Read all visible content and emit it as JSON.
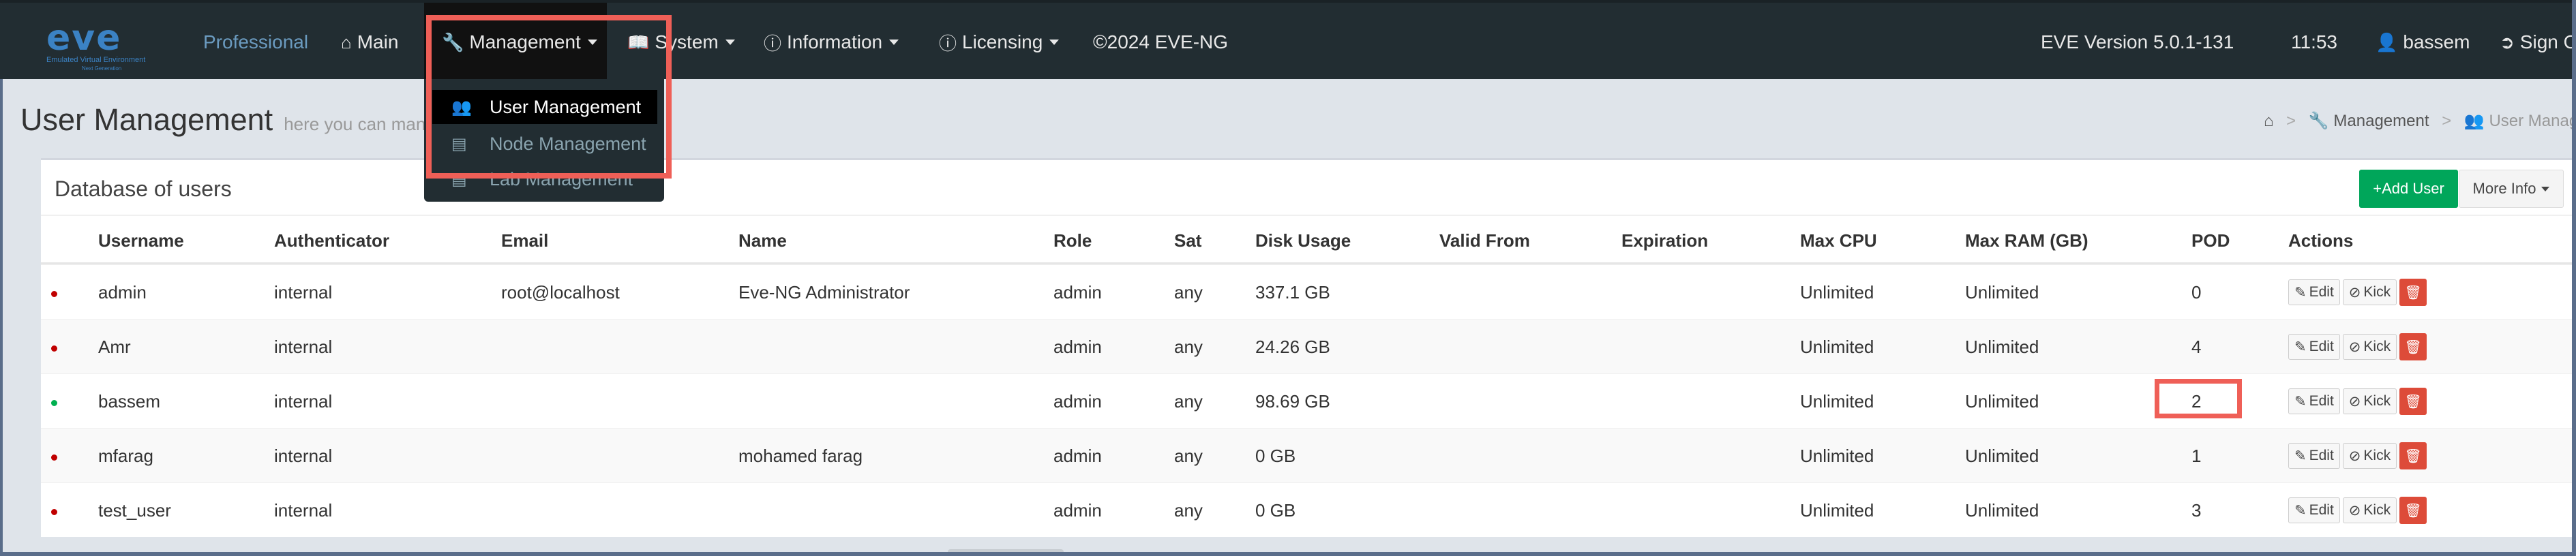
{
  "navbar": {
    "logo_text": "eve",
    "logo_tagline": "Emulated Virtual Environment",
    "logo_subtag": "Next Generation",
    "professional": "Professional",
    "main": "Main",
    "management": "Management",
    "system": "System",
    "information": "Information",
    "licensing": "Licensing",
    "copyright": "©2024 EVE-NG",
    "version": "EVE Version 5.0.1-131",
    "time": "11:53",
    "user": "bassem",
    "signout": "Sign Out"
  },
  "dropdown": {
    "items": [
      {
        "label": "User Management",
        "icon": "users-icon"
      },
      {
        "label": "Node Management",
        "icon": "hdd-icon"
      },
      {
        "label": "Lab Management",
        "icon": "hdd-icon"
      }
    ]
  },
  "page": {
    "title": "User Management",
    "subtitle": "here you can manage users",
    "breadcrumb": [
      "Management",
      "User Management"
    ]
  },
  "box": {
    "title": "Database of users",
    "add_user": "+Add User",
    "more_info": "More Info"
  },
  "table": {
    "headers": [
      "Username",
      "Authenticator",
      "Email",
      "Name",
      "Role",
      "Sat",
      "Disk Usage",
      "Valid From",
      "Expiration",
      "Max CPU",
      "Max RAM (GB)",
      "POD",
      "Actions"
    ],
    "rows": [
      {
        "status": "offline",
        "status_color": "#c00000",
        "username": "admin",
        "auth": "internal",
        "email": "root@localhost",
        "name": "Eve-NG Administrator",
        "role": "admin",
        "sat": "any",
        "disk": "337.1 GB",
        "valid": "",
        "exp": "",
        "cpu": "Unlimited",
        "ram": "Unlimited",
        "pod": "0"
      },
      {
        "status": "offline",
        "status_color": "#c00000",
        "username": "Amr",
        "auth": "internal",
        "email": "",
        "name": "",
        "role": "admin",
        "sat": "any",
        "disk": "24.26 GB",
        "valid": "",
        "exp": "",
        "cpu": "Unlimited",
        "ram": "Unlimited",
        "pod": "4"
      },
      {
        "status": "online",
        "status_color": "#00b050",
        "username": "bassem",
        "auth": "internal",
        "email": "",
        "name": "",
        "role": "admin",
        "sat": "any",
        "disk": "98.69 GB",
        "valid": "",
        "exp": "",
        "cpu": "Unlimited",
        "ram": "Unlimited",
        "pod": "2"
      },
      {
        "status": "offline",
        "status_color": "#c00000",
        "username": "mfarag",
        "auth": "internal",
        "email": "",
        "name": "mohamed farag",
        "role": "admin",
        "sat": "any",
        "disk": "0 GB",
        "valid": "",
        "exp": "",
        "cpu": "Unlimited",
        "ram": "Unlimited",
        "pod": "1"
      },
      {
        "status": "offline",
        "status_color": "#c00000",
        "username": "test_user",
        "auth": "internal",
        "email": "",
        "name": "",
        "role": "admin",
        "sat": "any",
        "disk": "0 GB",
        "valid": "",
        "exp": "",
        "cpu": "Unlimited",
        "ram": "Unlimited",
        "pod": "3"
      }
    ],
    "actions": {
      "edit": "Edit",
      "kick": "Kick"
    }
  },
  "colors": {
    "navbar_bg": "#222d32",
    "highlight": "#ef5f57",
    "add_button": "#00a65a",
    "delete_button": "#dd4b39"
  }
}
